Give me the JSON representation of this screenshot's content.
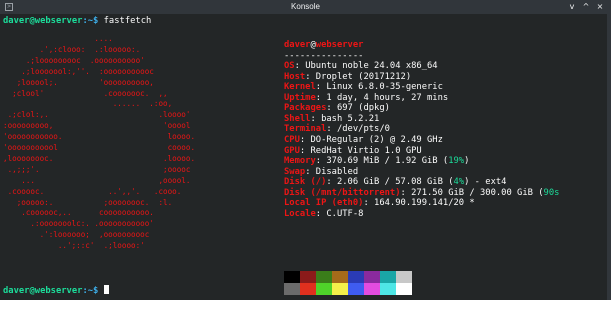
{
  "window": {
    "title": "Konsole",
    "app_icon": "terminal-icon",
    "buttons": [
      "v",
      "^",
      "×"
    ]
  },
  "terminal": {
    "prompt1": {
      "user_host": "daver@webserver",
      "path": ":~$",
      "command": "fastfetch"
    },
    "logo_lines": [
      "                    ....",
      "        .',:clooo:  .:looooo:.",
      "     .;looooooooc  .oooooooooo'",
      "    .;looooool:,''.  :ooooooooooc",
      "   ;looool;.         'oooooooooo,",
      "  ;clool'             .cooooooc.  ,,",
      "                        ......  .:oo,",
      " .;clol:,.                        .loooo'",
      ":ooooooooo,                        'ooool",
      "'ooooooooooo.                       loooo.",
      "'ooooooooool                        coooo.",
      ",loooooooc.                        .loooo.",
      " .,;;;'.                           ;ooooc",
      "    ...                           ,ooool.",
      " .cooooc.              ..',,'.   .cooo.",
      "   ;ooooo:.           ;oooooooc.  :l.",
      "    .coooooc,..      coooooooooo.",
      "      .:ooooooolc:. .ooooooooooo'",
      "        .':loooooo;  ,oooooooooc",
      "            ..';::c'  .;loooo:'"
    ],
    "info": {
      "user": "daver",
      "at": "@",
      "host": "webserver",
      "separator": "---------------",
      "lines": [
        {
          "key": "OS",
          "value": "Ubuntu noble 24.04 x86_64"
        },
        {
          "key": "Host",
          "value": "Droplet (20171212)"
        },
        {
          "key": "Kernel",
          "value": "Linux 6.8.0-35-generic"
        },
        {
          "key": "Uptime",
          "value": "1 day, 4 hours, 27 mins"
        },
        {
          "key": "Packages",
          "value": "697 (dpkg)"
        },
        {
          "key": "Shell",
          "value": "bash 5.2.21"
        },
        {
          "key": "Terminal",
          "value": "/dev/pts/0"
        },
        {
          "key": "CPU",
          "value": "DO-Regular (2) @ 2.49 GHz"
        },
        {
          "key": "GPU",
          "value": "RedHat Virtio 1.0 GPU"
        },
        {
          "key": "Memory",
          "value": "370.69 MiB / 1.92 GiB",
          "pct": "19%"
        },
        {
          "key": "Swap",
          "value": "Disabled"
        },
        {
          "key": "Disk (/)",
          "value": "2.06 GiB / 57.08 GiB",
          "pct": "4%",
          "suffix": " - ext4"
        },
        {
          "key": "Disk (/mnt/bittorrent)",
          "value": "271.50 GiB / 300.00 GiB",
          "pct": "90s"
        },
        {
          "key": "Local IP (eth0)",
          "value": "164.90.199.141/20 *"
        },
        {
          "key": "Locale",
          "value": "C.UTF-8"
        }
      ]
    },
    "palette_top": [
      "#000000",
      "#8b1a1a",
      "#3a7d1a",
      "#a66b1a",
      "#2a3bb5",
      "#8a2a9e",
      "#1aa6a6",
      "#c8c8c8"
    ],
    "palette_bottom": [
      "#6b6b6b",
      "#e0301e",
      "#4fd32a",
      "#f4f04a",
      "#3f5cf0",
      "#e34ce0",
      "#4ee6e6",
      "#ffffff"
    ],
    "prompt2": {
      "user_host": "daver@webserver",
      "path": ":~$"
    }
  }
}
